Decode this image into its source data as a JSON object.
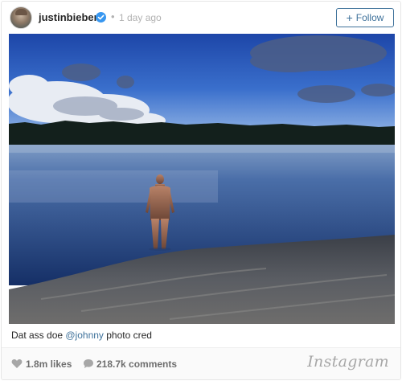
{
  "post": {
    "username": "justinbieber",
    "separator": "•",
    "time_ago": "1 day ago",
    "follow_label": "Follow",
    "follow_icon": "+"
  },
  "caption": {
    "text_before": "Dat ass doe ",
    "mention": "@johnny",
    "text_after": " photo cred"
  },
  "stats": {
    "likes": "1.8m likes",
    "comments": "218.7k comments"
  },
  "branding": {
    "logo_text": "Instagram"
  },
  "colors": {
    "link": "#3f729b",
    "verified": "#3897f0",
    "muted": "#b2b2b2"
  },
  "icons": [
    "verified-badge-icon",
    "heart-icon",
    "comment-icon",
    "instagram-logo"
  ]
}
